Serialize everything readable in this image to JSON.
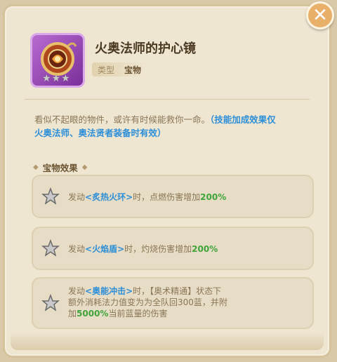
{
  "item": {
    "name": "火奥法师的护心镜",
    "type_label": "类型",
    "type_value": "宝物",
    "stars": [
      "★",
      "★",
      "★"
    ]
  },
  "description": {
    "text": "看似不起眼的物件，或许有时候能救你一命。",
    "highlight_line1": "（技能加成效果仅",
    "highlight_line2": "火奥法师、奥法贤者装备时有效）"
  },
  "effects_section": {
    "title": "宝物效果",
    "left_deco": "◆",
    "right_deco": "◆"
  },
  "effects": [
    {
      "prefix": "发动",
      "skill": "<炙热火环>",
      "mid": "时，点燃伤害增加",
      "pct": "200%"
    },
    {
      "prefix": "发动",
      "skill": "<火焰盾>",
      "mid": "时，灼烧伤害增加",
      "pct": "200%"
    },
    {
      "prefix": "发动",
      "skill": "<奥能冲击>",
      "mid": "时，【奥术精通】状态下",
      "line2": "额外消耗法力值变为为全队回300蓝，并附",
      "line3_prefix": "加",
      "pct": "5000%",
      "line3_suffix": "当前蓝量的伤害"
    }
  ],
  "close": {
    "label": "✕"
  },
  "colors": {
    "skill": "#2c8fd8",
    "percent": "#3fa53a",
    "panel": "#efe6d2",
    "close": "#e9b06a"
  }
}
